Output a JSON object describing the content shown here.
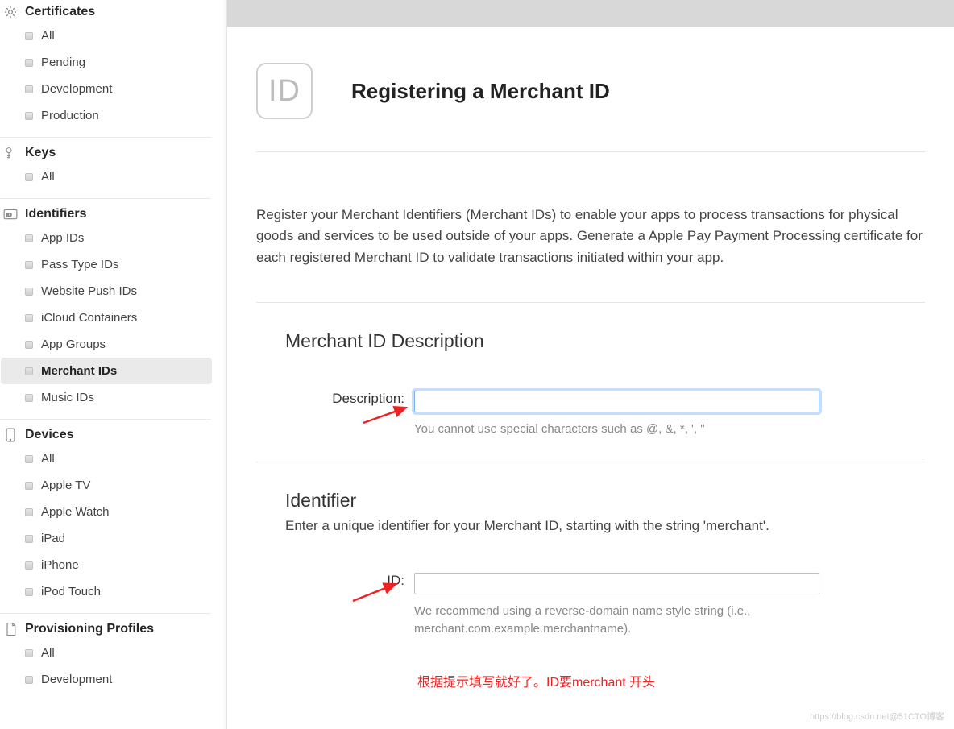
{
  "sidebar": {
    "sections": [
      {
        "title": "Certificates",
        "icon": "gear-icon",
        "items": [
          {
            "label": "All"
          },
          {
            "label": "Pending"
          },
          {
            "label": "Development"
          },
          {
            "label": "Production"
          }
        ]
      },
      {
        "title": "Keys",
        "icon": "key-icon",
        "items": [
          {
            "label": "All"
          }
        ]
      },
      {
        "title": "Identifiers",
        "icon": "id-icon",
        "items": [
          {
            "label": "App IDs"
          },
          {
            "label": "Pass Type IDs"
          },
          {
            "label": "Website Push IDs"
          },
          {
            "label": "iCloud Containers"
          },
          {
            "label": "App Groups"
          },
          {
            "label": "Merchant IDs",
            "active": true
          },
          {
            "label": "Music IDs"
          }
        ]
      },
      {
        "title": "Devices",
        "icon": "device-icon",
        "items": [
          {
            "label": "All"
          },
          {
            "label": "Apple TV"
          },
          {
            "label": "Apple Watch"
          },
          {
            "label": "iPad"
          },
          {
            "label": "iPhone"
          },
          {
            "label": "iPod Touch"
          }
        ]
      },
      {
        "title": "Provisioning Profiles",
        "icon": "profile-icon",
        "items": [
          {
            "label": "All"
          },
          {
            "label": "Development"
          }
        ]
      }
    ]
  },
  "main": {
    "badge": "ID",
    "title": "Registering a Merchant ID",
    "intro": "Register your Merchant Identifiers (Merchant IDs) to enable your apps to process transactions for physical goods and services to be used outside of your apps. Generate a Apple Pay Payment Processing certificate for each registered Merchant ID to validate transactions initiated within your app.",
    "description_section": {
      "heading": "Merchant ID Description",
      "label": "Description:",
      "value": "",
      "hint": "You cannot use special characters such as @, &, *, ', \""
    },
    "identifier_section": {
      "heading": "Identifier",
      "sub": "Enter a unique identifier for your Merchant ID, starting with the string 'merchant'.",
      "label": "ID:",
      "value": "",
      "hint": "We recommend using a reverse-domain name style string (i.e., merchant.com.example.merchantname)."
    },
    "annotation": "根据提示填写就好了。ID要merchant 开头",
    "watermark": "https://blog.csdn.net@51CTO博客"
  }
}
